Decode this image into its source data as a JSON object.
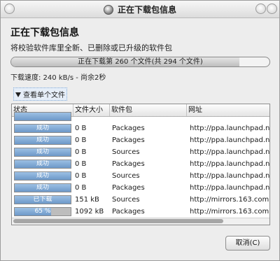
{
  "window": {
    "title": "正在下载包信息"
  },
  "header": {
    "heading": "正在下载包信息",
    "description": "将校验软件库里全新、已删除或已升级的软件包"
  },
  "overall_progress": {
    "text": "正在下载第 260 个文件(共 294 个文件)",
    "fraction": 0.884
  },
  "speed_text": "下载速度: 240 kB/s - 尚余2秒",
  "details_toggle": "查看单个文件",
  "table": {
    "headers": [
      "状态",
      "文件大小",
      "软件包",
      "网址"
    ],
    "rows": [
      {
        "status": "",
        "progress": 1.0,
        "size": "",
        "package": "",
        "url": ""
      },
      {
        "status": "成功",
        "progress": 1.0,
        "size": "0 B",
        "package": "Packages",
        "url": "http://ppa.launchpad.net"
      },
      {
        "status": "成功",
        "progress": 1.0,
        "size": "0 B",
        "package": "Packages",
        "url": "http://ppa.launchpad.net"
      },
      {
        "status": "成功",
        "progress": 1.0,
        "size": "0 B",
        "package": "Sources",
        "url": "http://ppa.launchpad.net"
      },
      {
        "status": "成功",
        "progress": 1.0,
        "size": "0 B",
        "package": "Packages",
        "url": "http://ppa.launchpad.net"
      },
      {
        "status": "成功",
        "progress": 1.0,
        "size": "0 B",
        "package": "Sources",
        "url": "http://ppa.launchpad.net"
      },
      {
        "status": "成功",
        "progress": 1.0,
        "size": "0 B",
        "package": "Packages",
        "url": "http://ppa.launchpad.net"
      },
      {
        "status": "已下载",
        "progress": 1.0,
        "size": "151 kB",
        "package": "Sources",
        "url": "http://mirrors.163.com"
      },
      {
        "status": "65 %",
        "progress": 0.65,
        "size": "1092 kB",
        "package": "Packages",
        "url": "http://mirrors.163.com"
      }
    ]
  },
  "buttons": {
    "cancel": "取消(C)"
  },
  "colors": {
    "accent": "#6d98c8",
    "window_bg": "#ededed"
  }
}
